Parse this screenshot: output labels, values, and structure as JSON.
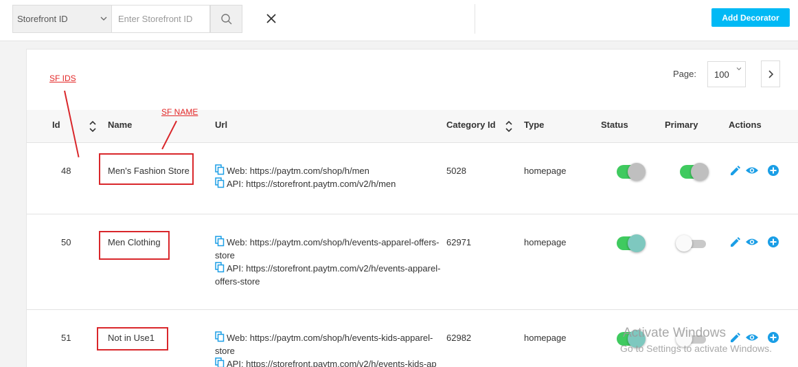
{
  "search": {
    "filter_value": "Storefront ID",
    "placeholder": "Enter Storefront ID"
  },
  "toolbar": {
    "add_label": "Add Decorator"
  },
  "pagination": {
    "label": "Page:",
    "value": "100"
  },
  "table": {
    "headers": {
      "id": "Id",
      "name": "Name",
      "url": "Url",
      "category": "Category Id",
      "type": "Type",
      "status": "Status",
      "primary": "Primary",
      "actions": "Actions"
    },
    "rows": [
      {
        "id": "48",
        "name": "Men's Fashion Store",
        "web": "Web: https://paytm.com/shop/h/men",
        "api": "API: https://storefront.paytm.com/v2/h/men",
        "category": "5028",
        "type": "homepage",
        "status": true,
        "primary": true
      },
      {
        "id": "50",
        "name": "Men Clothing",
        "web": "Web: https://paytm.com/shop/h/events-apparel-offers-store",
        "api": "API: https://storefront.paytm.com/v2/h/events-apparel-offers-store",
        "category": "62971",
        "type": "homepage",
        "status": true,
        "primary": false
      },
      {
        "id": "51",
        "name": "Not in Use1",
        "web": "Web: https://paytm.com/shop/h/events-kids-apparel-store",
        "api": "API: https://storefront.paytm.com/v2/h/events-kids-ap",
        "category": "62982",
        "type": "homepage",
        "status": true,
        "primary": false
      }
    ]
  },
  "annotations": {
    "ids": "SF IDS",
    "name": "SF NAME"
  },
  "watermark": {
    "line1": "Activate Windows",
    "line2": "Go to Settings to activate Windows."
  },
  "colors": {
    "accent": "#00b9f5",
    "toggle_on": "#3fca5f",
    "annotation": "#d9262a",
    "icon": "#1a9ee6"
  }
}
